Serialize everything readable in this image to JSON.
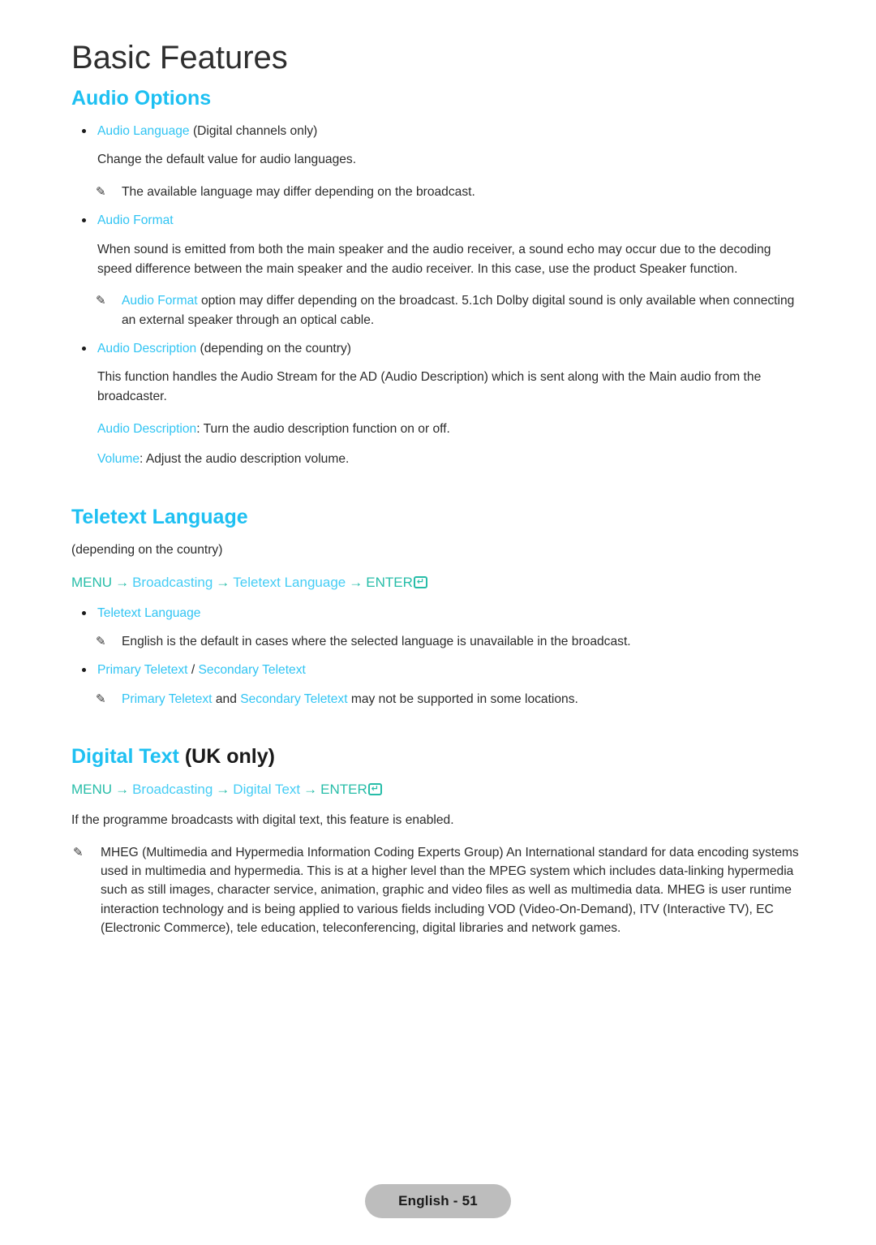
{
  "page": {
    "title": "Basic Features",
    "footer_label": "English - 51"
  },
  "audio_options": {
    "heading": "Audio Options",
    "audio_language": {
      "term": "Audio Language",
      "suffix": " (Digital channels only)",
      "description": "Change the default value for audio languages.",
      "note": "The available language may differ depending on the broadcast."
    },
    "audio_format": {
      "term": "Audio Format",
      "description": "When sound is emitted from both the main speaker and the audio receiver, a sound echo may occur due to the decoding speed difference between the main speaker and the audio receiver. In this case, use the product Speaker function.",
      "note_term": "Audio Format",
      "note_rest": " option may differ depending on the broadcast. 5.1ch Dolby digital sound is only available when connecting an external speaker through an optical cable."
    },
    "audio_description": {
      "term": "Audio Description",
      "suffix": " (depending on the country)",
      "description": "This function handles the Audio Stream for the AD (Audio Description) which is sent along with the Main audio from the broadcaster.",
      "option_1_term": "Audio Description",
      "option_1_rest": ": Turn the audio description function on or off.",
      "option_2_term": "Volume",
      "option_2_rest": ": Adjust the audio description volume."
    }
  },
  "teletext_language": {
    "heading": "Teletext Language",
    "subtitle": "(depending on the country)",
    "menu_path": {
      "menu": "MENU",
      "arrow": "→",
      "step_1": "Broadcasting",
      "step_2": "Teletext Language",
      "enter": "ENTER",
      "enter_glyph": "↵"
    },
    "item_term": "Teletext Language",
    "item_note": "English is the default in cases where the selected language is unavailable in the broadcast.",
    "primary_term": "Primary Teletext",
    "separator": " / ",
    "secondary_term": "Secondary Teletext",
    "note_primary": "Primary Teletext",
    "note_and": " and ",
    "note_secondary": "Secondary Teletext",
    "note_rest": " may not be supported in some locations."
  },
  "digital_text": {
    "heading_cyan": "Digital Text",
    "heading_dark": " (UK only)",
    "menu_path": {
      "menu": "MENU",
      "arrow": "→",
      "step_1": "Broadcasting",
      "step_2": "Digital Text",
      "enter": "ENTER",
      "enter_glyph": "↵"
    },
    "description": "If the programme broadcasts with digital text, this feature is enabled.",
    "note": "MHEG (Multimedia and Hypermedia Information Coding Experts Group) An International standard for data encoding systems used in multimedia and hypermedia. This is at a higher level than the MPEG system which includes data-linking hypermedia such as still images, character service, animation, graphic and video files as well as multimedia data. MHEG is user runtime interaction technology and is being applied to various fields including VOD (Video-On-Demand), ITV (Interactive TV), EC (Electronic Commerce), tele education, teleconferencing, digital libraries and network games."
  },
  "icons": {
    "pencil": "✎",
    "bullet": "•"
  },
  "colors": {
    "accent_cyan": "#1ec0f2",
    "link_cyan": "#30c4f3",
    "menu_teal": "#27bda8",
    "body_text": "#2b2b2b",
    "footer_pill": "#bdbdbd"
  }
}
